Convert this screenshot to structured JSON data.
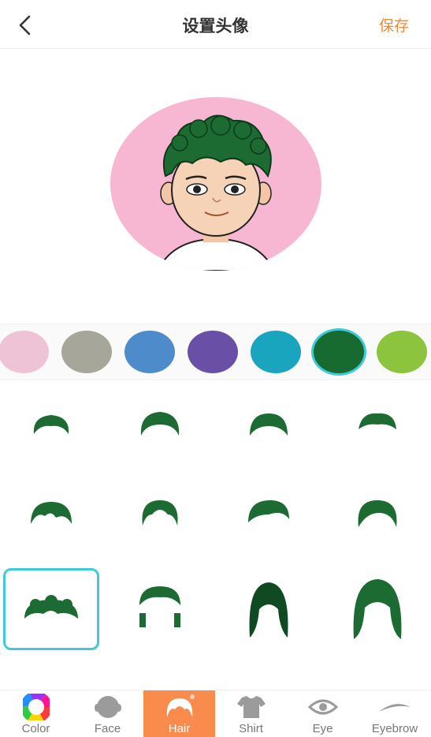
{
  "header": {
    "title": "设置头像",
    "save_label": "保存",
    "back_icon": "chevron-left-icon"
  },
  "avatar": {
    "background_color": "#f7b6d2",
    "hair_color": "#1c6b33"
  },
  "swatches": [
    {
      "color": "#efc3d6",
      "selected": false
    },
    {
      "color": "#a6a69a",
      "selected": false
    },
    {
      "color": "#4e8bcb",
      "selected": false
    },
    {
      "color": "#6a4fa6",
      "selected": false
    },
    {
      "color": "#18a5bd",
      "selected": false
    },
    {
      "color": "#176b30",
      "selected": true
    },
    {
      "color": "#8cc43e",
      "selected": false
    }
  ],
  "hair_styles": [
    {
      "style": "short-1",
      "selected": false
    },
    {
      "style": "short-2",
      "selected": false
    },
    {
      "style": "short-3",
      "selected": false
    },
    {
      "style": "short-4",
      "selected": false
    },
    {
      "style": "messy-1",
      "selected": false
    },
    {
      "style": "messy-2",
      "selected": false
    },
    {
      "style": "swept-1",
      "selected": false
    },
    {
      "style": "swept-2",
      "selected": false
    },
    {
      "style": "curly-1",
      "selected": true
    },
    {
      "style": "curly-2",
      "selected": false
    },
    {
      "style": "long-1",
      "selected": false
    },
    {
      "style": "long-2",
      "selected": false
    }
  ],
  "nav": {
    "items": [
      {
        "label": "Color",
        "icon": "color-wheel-icon",
        "active": false
      },
      {
        "label": "Face",
        "icon": "face-icon",
        "active": false
      },
      {
        "label": "Hair",
        "icon": "hair-icon",
        "active": true
      },
      {
        "label": "Shirt",
        "icon": "shirt-icon",
        "active": false
      },
      {
        "label": "Eye",
        "icon": "eye-icon",
        "active": false
      },
      {
        "label": "Eyebrow",
        "icon": "eyebrow-icon",
        "active": false
      }
    ]
  },
  "colors": {
    "accent": "#ee8a3c",
    "active_tab": "#f98b4c",
    "selection": "#3fcad7"
  }
}
